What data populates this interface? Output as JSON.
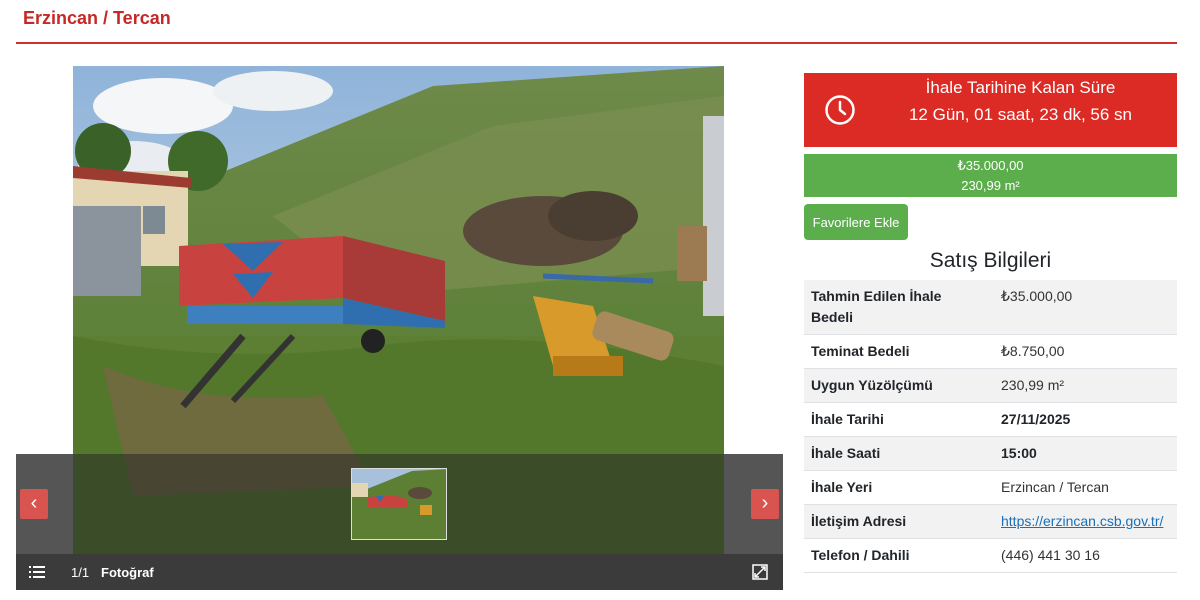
{
  "page": {
    "title": "Erzincan / Tercan"
  },
  "gallery": {
    "counter": "1/1",
    "label": "Fotoğraf",
    "prev_icon": "chevron-left-icon",
    "next_icon": "chevron-right-icon",
    "list_icon": "list-icon",
    "expand_icon": "expand-icon",
    "prev_glyph": "‹",
    "next_glyph": "›"
  },
  "countdown": {
    "title": "İhale Tarihine Kalan Süre",
    "value": "12 Gün, 01 saat, 23 dk, 56 sn",
    "icon": "clock-icon",
    "color": "#dc2a24"
  },
  "price": {
    "amount": "₺35.000,00",
    "area": "230,99 m²",
    "color": "#5cae4c"
  },
  "favorites_button": {
    "label": "Favorilere Ekle"
  },
  "sale_info": {
    "title": "Satış Bilgileri",
    "rows": [
      {
        "label": "Tahmin Edilen İhale Bedeli",
        "value": "₺35.000,00"
      },
      {
        "label": "Teminat Bedeli",
        "value": "₺8.750,00"
      },
      {
        "label": "Uygun Yüzölçümü",
        "value": "230,99 m²"
      },
      {
        "label": "İhale Tarihi",
        "value": "27/11/2025"
      },
      {
        "label": "İhale Saati",
        "value": "15:00"
      },
      {
        "label": "İhale Yeri",
        "value": "Erzincan / Tercan"
      },
      {
        "label": "İletişim Adresi",
        "value": "https://erzincan.csb.gov.tr/"
      },
      {
        "label": "Telefon / Dahili",
        "value": "(446) 441 30 16"
      }
    ]
  }
}
